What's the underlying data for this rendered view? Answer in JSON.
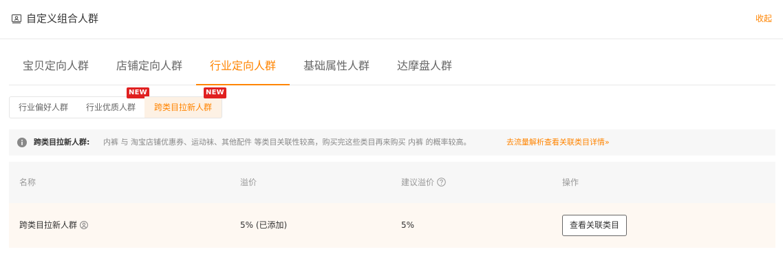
{
  "header": {
    "title": "自定义组合人群",
    "collapse_label": "收起"
  },
  "main_tabs": [
    {
      "label": "宝贝定向人群",
      "active": false
    },
    {
      "label": "店铺定向人群",
      "active": false
    },
    {
      "label": "行业定向人群",
      "active": true
    },
    {
      "label": "基础属性人群",
      "active": false
    },
    {
      "label": "达摩盘人群",
      "active": false
    }
  ],
  "sub_tabs": [
    {
      "label": "行业偏好人群",
      "badge": "",
      "active": false
    },
    {
      "label": "行业优质人群",
      "badge": "NEW",
      "active": false
    },
    {
      "label": "跨类目拉新人群",
      "badge": "NEW",
      "active": true
    }
  ],
  "info": {
    "label": "跨类目拉新人群:",
    "text": "内裤 与 淘宝店铺优惠券、运动袜、其他配件 等类目关联性较高，购买完这些类目再来购买 内裤 的概率较高。",
    "link": "去流量解析查看关联类目详情»"
  },
  "table": {
    "headers": {
      "name": "名称",
      "premium": "溢价",
      "suggested": "建议溢价",
      "action": "操作"
    },
    "rows": [
      {
        "name": "跨类目拉新人群",
        "premium": "5% (已添加)",
        "suggested": "5%",
        "action": "查看关联类目"
      }
    ]
  },
  "colors": {
    "accent": "#ff8400",
    "badge": "#e02020",
    "row_highlight": "#fef8f2",
    "active_subtab_bg": "#fdf1e4"
  },
  "icons": {
    "header": "group-card-icon",
    "info": "info-circle-icon",
    "help": "question-circle-icon",
    "row": "user-circle-icon"
  }
}
